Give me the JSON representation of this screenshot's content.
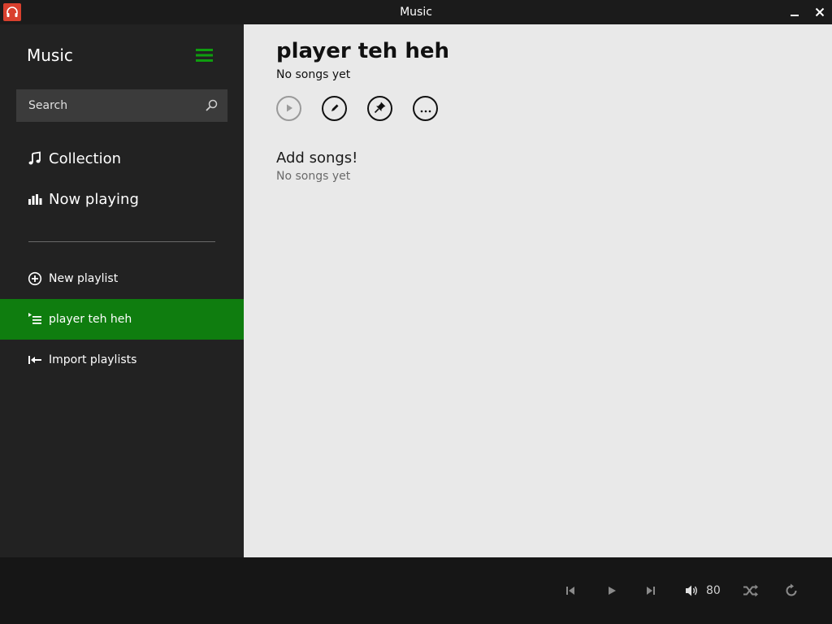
{
  "window": {
    "title": "Music",
    "icon": "headphones-icon"
  },
  "sidebar": {
    "title": "Music",
    "search": {
      "placeholder": "Search"
    },
    "nav": [
      {
        "label": "Collection",
        "icon": "music-note-icon"
      },
      {
        "label": "Now playing",
        "icon": "bar-chart-icon"
      }
    ],
    "playlists": [
      {
        "label": "New playlist",
        "icon": "plus-circle-icon",
        "active": false
      },
      {
        "label": "player teh heh",
        "icon": "playlist-icon",
        "active": true
      },
      {
        "label": "Import playlists",
        "icon": "import-icon",
        "active": false
      }
    ]
  },
  "main": {
    "playlist_title": "player teh heh",
    "playlist_subtitle": "No songs yet",
    "actions": [
      "play-icon",
      "edit-icon",
      "pin-icon",
      "more-icon"
    ],
    "empty_title": "Add songs!",
    "empty_subtitle": "No songs yet"
  },
  "player": {
    "volume": "80"
  },
  "colors": {
    "accent": "#0f7d0f",
    "sidebar_bg": "#222222",
    "main_bg": "#e9e9e9",
    "app_icon": "#d9402e"
  }
}
